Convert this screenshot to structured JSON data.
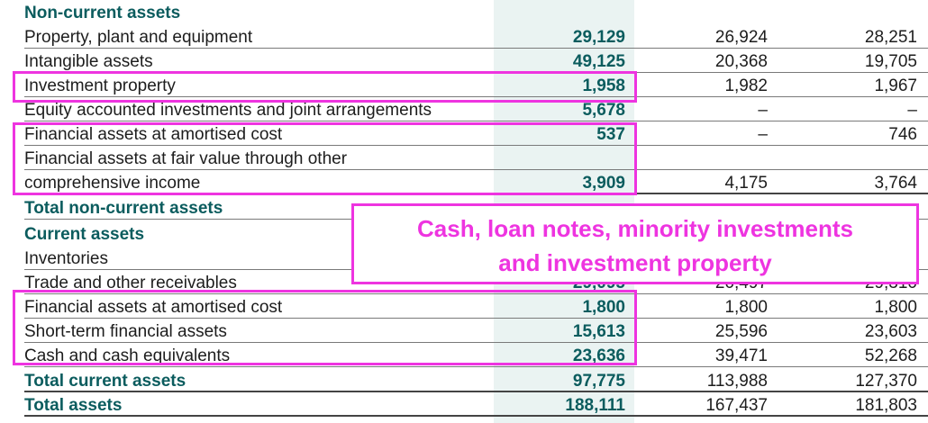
{
  "rows": [
    {
      "label": "Non-current assets",
      "type": "section",
      "c1": "",
      "c2": "",
      "c3": ""
    },
    {
      "label": "Property, plant and equipment",
      "type": "item",
      "c1": "29,129",
      "c2": "26,924",
      "c3": "28,251"
    },
    {
      "label": "Intangible assets",
      "type": "item",
      "c1": "49,125",
      "c2": "20,368",
      "c3": "19,705"
    },
    {
      "label": "Investment property",
      "type": "item",
      "c1": "1,958",
      "c2": "1,982",
      "c3": "1,967"
    },
    {
      "label": "Equity accounted investments and joint arrangements",
      "type": "item",
      "c1": "5,678",
      "c2": "–",
      "c3": "–"
    },
    {
      "label": "Financial assets at amortised cost",
      "type": "item",
      "c1": "537",
      "c2": "–",
      "c3": "746"
    },
    {
      "label": "Financial assets at fair value through other",
      "type": "item",
      "c1": "",
      "c2": "",
      "c3": ""
    },
    {
      "label": "comprehensive income",
      "type": "item",
      "c1": "3,909",
      "c2": "4,175",
      "c3": "3,764"
    },
    {
      "label": "Total non-current assets",
      "type": "section",
      "c1": "",
      "c2": "",
      "c3": ""
    },
    {
      "label": "Current assets",
      "type": "section",
      "c1": "",
      "c2": "",
      "c3": ""
    },
    {
      "label": "Inventories",
      "type": "item",
      "c1": "",
      "c2": "",
      "c3": ""
    },
    {
      "label": "Trade and other receivables",
      "type": "item",
      "c1": "29,095",
      "c2": "20,497",
      "c3": "29,310"
    },
    {
      "label": "Financial assets at amortised cost",
      "type": "item",
      "c1": "1,800",
      "c2": "1,800",
      "c3": "1,800"
    },
    {
      "label": "Short-term financial assets",
      "type": "item",
      "c1": "15,613",
      "c2": "25,596",
      "c3": "23,603"
    },
    {
      "label": "Cash and cash equivalents",
      "type": "item",
      "c1": "23,636",
      "c2": "39,471",
      "c3": "52,268"
    },
    {
      "label": "Total current assets",
      "type": "total",
      "c1": "97,775",
      "c2": "113,988",
      "c3": "127,370"
    },
    {
      "label": "Total assets",
      "type": "total",
      "c1": "188,111",
      "c2": "167,437",
      "c3": "181,803"
    }
  ],
  "callout": {
    "line1": "Cash, loan notes, minority investments",
    "line2": "and investment property"
  },
  "colors": {
    "highlight": "#ee34e0",
    "teal": "#0b5c5e",
    "shade": "#eaf3f2"
  }
}
